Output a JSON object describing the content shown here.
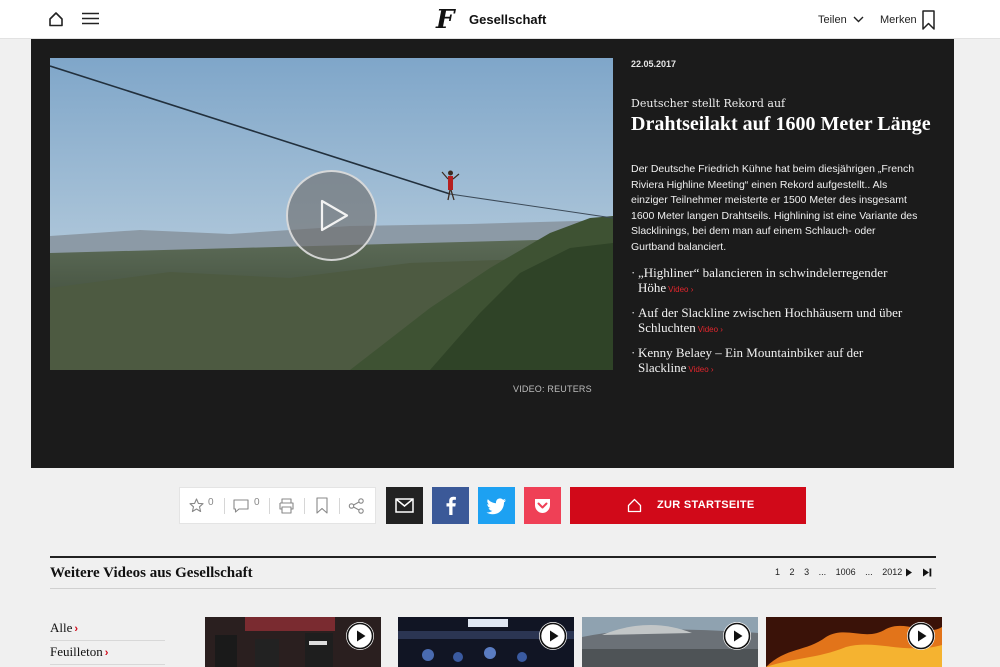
{
  "header": {
    "logo": "F",
    "section_title": "Gesellschaft",
    "share_label": "Teilen",
    "bookmark_label": "Merken"
  },
  "video": {
    "credit": "VIDEO: REUTERS"
  },
  "article": {
    "date": "22.05.2017",
    "kicker": "Deutscher stellt Rekord auf",
    "headline": "Drahtseilakt auf 1600 Meter Länge",
    "teaser": "Der Deutsche Friedrich Kühne hat beim diesjährigen „French Riviera Highline Meeting“ einen Rekord aufgestellt.. Als einziger Teilnehmer meisterte er 1500 Meter des insgesamt 1600 Meter langen Drahtseils. Highlining ist eine Variante des Slacklinings, bei dem man auf einem Schlauch- oder Gurtband balanciert.",
    "related": [
      {
        "text": "„Highliner“ balancieren in schwindelerregender Höhe",
        "tag": "Video ›"
      },
      {
        "text": "Auf der Slackline zwischen Hochhäusern und über Schluchten",
        "tag": "Video ›"
      },
      {
        "text": "Kenny Belaey – Ein Mountainbiker auf der Slackline",
        "tag": "Video ›"
      }
    ]
  },
  "tools": {
    "favorites_count": "0",
    "comments_count": "0"
  },
  "start_button_label": "ZUR STARTSEITE",
  "colors": {
    "accent_red": "#d10919",
    "facebook": "#3b5998",
    "twitter": "#1da1f2",
    "pocket": "#ef4056",
    "email": "#222222"
  },
  "more": {
    "title": "Weitere Videos aus Gesellschaft",
    "pages": [
      "1",
      "2",
      "3",
      "...",
      "1006",
      "...",
      "2012"
    ]
  },
  "filters": [
    {
      "label": "Alle",
      "arrow": "›"
    },
    {
      "label": "Feuilleton",
      "arrow": "›"
    }
  ]
}
